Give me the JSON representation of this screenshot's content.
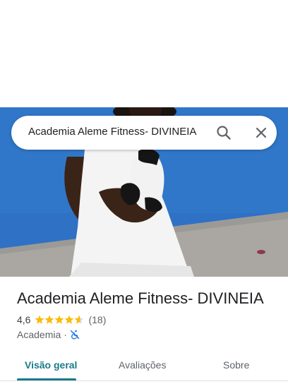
{
  "search": {
    "query": "Academia Aleme Fitness- DIVINEIA"
  },
  "place": {
    "name": "Academia Aleme Fitness- DIVINEIA",
    "rating": "4,6",
    "rating_value": 4.6,
    "review_count": "(18)",
    "category": "Academia",
    "separator": "·",
    "accessibility_icon": "wheelchair-not-accessible-icon"
  },
  "tabs": [
    {
      "label": "Visão geral",
      "active": true
    },
    {
      "label": "Avaliações",
      "active": false
    },
    {
      "label": "Sobre",
      "active": false
    }
  ],
  "colors": {
    "accent": "#1a7a8a",
    "star": "#fbbc04",
    "accessibility_icon": "#1a73e8",
    "photo_wall": "#2f73c5"
  }
}
